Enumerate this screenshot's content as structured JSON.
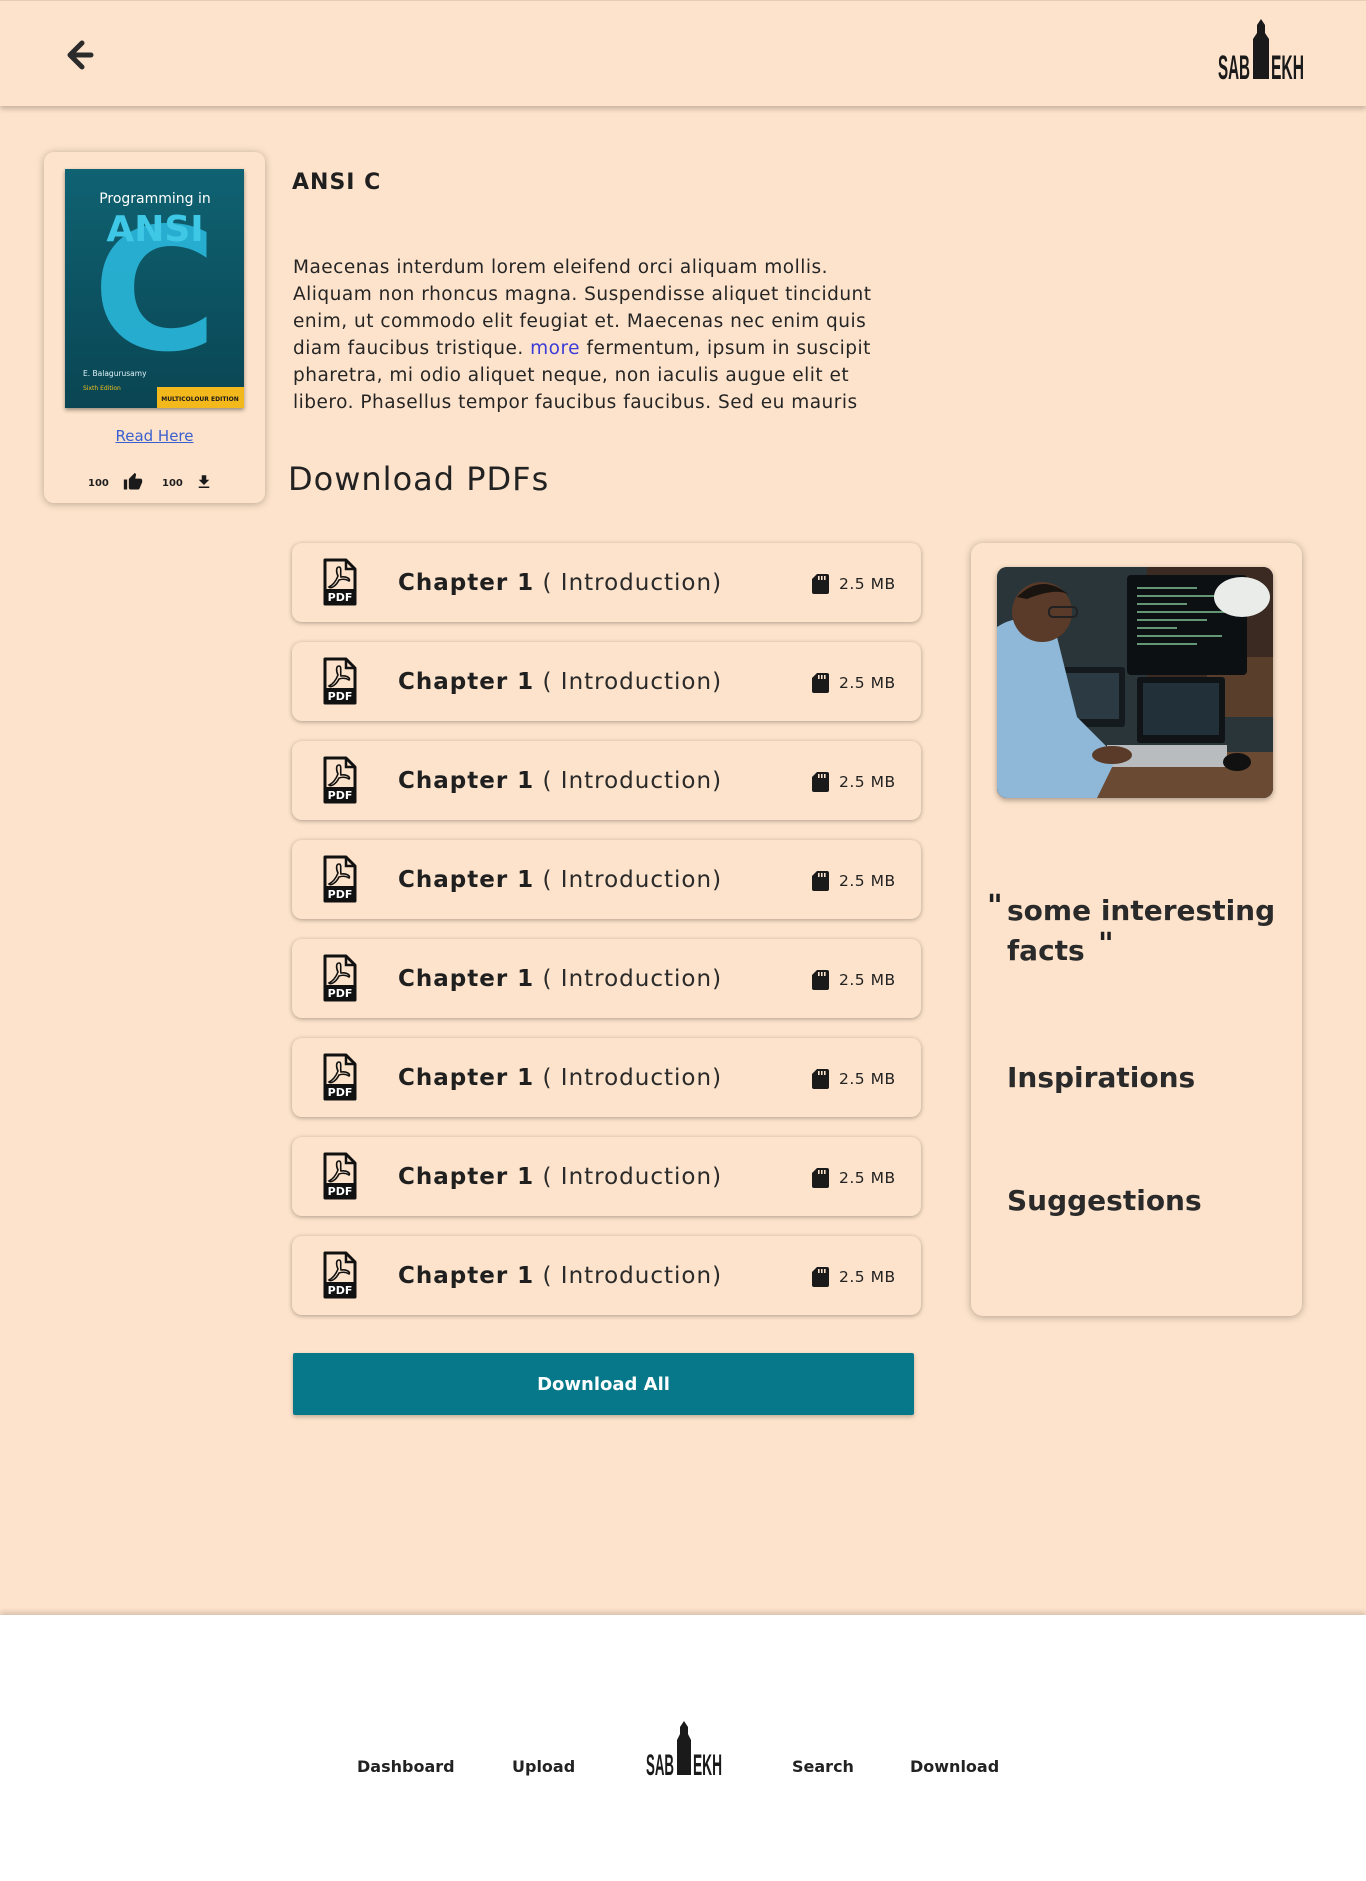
{
  "header": {
    "back_icon": "arrow-left-icon",
    "logo_text_left": "SAB",
    "logo_text_right": "EKH"
  },
  "book": {
    "title": "ANSI C",
    "cover": {
      "top_text": "Programming in",
      "big_text": "ANSI",
      "letter": "C",
      "author": "E. Balagurusamy",
      "edition": "Sixth Edition",
      "badge": "MULTICOLOUR EDITION"
    },
    "read_label": "Read Here",
    "likes": "100",
    "downloads": "100",
    "description_before": "Maecenas interdum lorem eleifend orci aliquam mollis. Aliquam non rhoncus magna. Suspendisse aliquet tincidunt enim, ut commodo elit feugiat et. Maecenas nec enim quis diam faucibus tristique. ",
    "more_label": "more",
    "description_after": " fermentum, ipsum in suscipit pharetra, mi odio aliquet neque, non iaculis augue elit et libero. Phasellus tempor faucibus faucibus. Sed eu mauris"
  },
  "downloads_section": {
    "title": "Download PDFs",
    "chapters": [
      {
        "name": "Chapter 1",
        "subtitle": "( Introduction)",
        "size": "2.5 MB"
      },
      {
        "name": "Chapter 1",
        "subtitle": "( Introduction)",
        "size": "2.5 MB"
      },
      {
        "name": "Chapter 1",
        "subtitle": "( Introduction)",
        "size": "2.5 MB"
      },
      {
        "name": "Chapter 1",
        "subtitle": "( Introduction)",
        "size": "2.5 MB"
      },
      {
        "name": "Chapter 1",
        "subtitle": "( Introduction)",
        "size": "2.5 MB"
      },
      {
        "name": "Chapter 1",
        "subtitle": "( Introduction)",
        "size": "2.5 MB"
      },
      {
        "name": "Chapter 1",
        "subtitle": "( Introduction)",
        "size": "2.5 MB"
      },
      {
        "name": "Chapter 1",
        "subtitle": "( Introduction)",
        "size": "2.5 MB"
      }
    ],
    "pdf_icon_label": "PDF",
    "download_all_label": "Download All"
  },
  "sidebar": {
    "quote_open": "\"",
    "quote": "some interesting facts",
    "quote_close": "\"",
    "inspirations_label": "Inspirations",
    "suggestions_label": "Suggestions"
  },
  "footer": {
    "dashboard": "Dashboard",
    "upload": "Upload",
    "search": "Search",
    "download": "Download"
  },
  "colors": {
    "background": "#fde3cb",
    "accent": "#06788a",
    "link": "#3a5fcf",
    "footer_bg": "#ffffff"
  }
}
